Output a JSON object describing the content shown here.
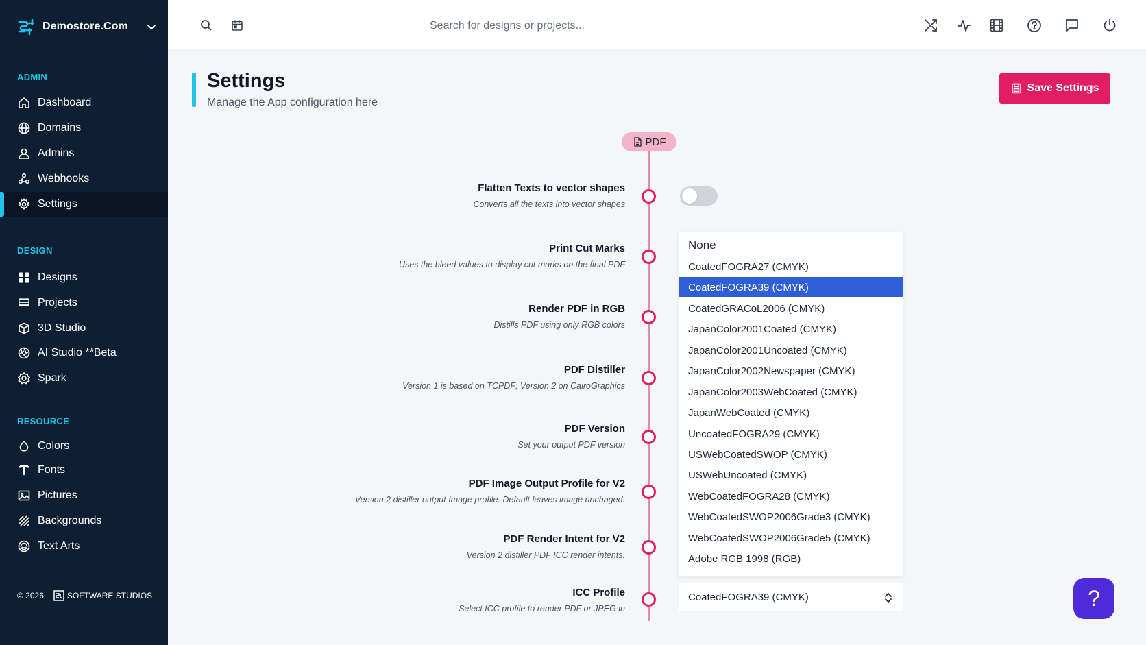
{
  "brand": {
    "name": "Demostore.Com"
  },
  "sidebar": {
    "sections": [
      {
        "label": "ADMIN",
        "items": [
          {
            "label": "Dashboard",
            "icon": "home-icon"
          },
          {
            "label": "Domains",
            "icon": "globe-icon"
          },
          {
            "label": "Admins",
            "icon": "user-icon"
          },
          {
            "label": "Webhooks",
            "icon": "webhook-icon"
          },
          {
            "label": "Settings",
            "icon": "gear-icon",
            "active": true
          }
        ]
      },
      {
        "label": "DESIGN",
        "items": [
          {
            "label": "Designs",
            "icon": "grid-icon"
          },
          {
            "label": "Projects",
            "icon": "list-icon"
          },
          {
            "label": "3D Studio",
            "icon": "cube-icon"
          },
          {
            "label": "AI Studio **Beta",
            "icon": "aperture-icon"
          },
          {
            "label": "Spark",
            "icon": "badge-gear-icon"
          }
        ]
      },
      {
        "label": "RESOURCE",
        "items": [
          {
            "label": "Colors",
            "icon": "droplet-icon"
          },
          {
            "label": "Fonts",
            "icon": "text-t-icon"
          },
          {
            "label": "Pictures",
            "icon": "image-icon"
          },
          {
            "label": "Backgrounds",
            "icon": "hatch-icon"
          },
          {
            "label": "Text Arts",
            "icon": "smiley-icon"
          }
        ]
      }
    ],
    "footer": {
      "year": "© 2026",
      "company": "SOFTWARE STUDIOS"
    }
  },
  "topbar": {
    "search_placeholder": "Search for designs or projects...",
    "icons": [
      "shuffle-icon",
      "activity-icon",
      "film-icon",
      "help-circle-icon",
      "message-icon",
      "power-icon"
    ]
  },
  "header": {
    "title": "Settings",
    "subtitle": "Manage the App configuration here",
    "save_label": "Save Settings"
  },
  "timeline": {
    "badge": "PDF"
  },
  "settings": [
    {
      "title": "Flatten Texts to vector shapes",
      "desc": "Converts all the texts into vector shapes"
    },
    {
      "title": "Print Cut Marks",
      "desc": "Uses the bleed values to display cut marks on the final PDF"
    },
    {
      "title": "Render PDF in RGB",
      "desc": "Distills PDF using only RGB colors"
    },
    {
      "title": "PDF Distiller",
      "desc": "Version 1 is based on TCPDF; Version 2 on CairoGraphics"
    },
    {
      "title": "PDF Version",
      "desc": "Set your output PDF version"
    },
    {
      "title": "PDF Image Output Profile for V2",
      "desc": "Version 2 distiller output Image profile. Default leaves image unchaged."
    },
    {
      "title": "PDF Render Intent for V2",
      "desc": "Version 2 distiller PDF ICC render intents."
    },
    {
      "title": "ICC Profile",
      "desc": "Select ICC profile to render PDF or JPEG in"
    }
  ],
  "flatten_toggle": {
    "on": false
  },
  "icc_dropdown": {
    "options": [
      "None",
      "CoatedFOGRA27 (CMYK)",
      "CoatedFOGRA39 (CMYK)",
      "CoatedGRACoL2006 (CMYK)",
      "JapanColor2001Coated (CMYK)",
      "JapanColor2001Uncoated (CMYK)",
      "JapanColor2002Newspaper (CMYK)",
      "JapanColor2003WebCoated (CMYK)",
      "JapanWebCoated (CMYK)",
      "UncoatedFOGRA29 (CMYK)",
      "USWebCoatedSWOP (CMYK)",
      "USWebUncoated (CMYK)",
      "WebCoatedFOGRA28 (CMYK)",
      "WebCoatedSWOP2006Grade3 (CMYK)",
      "WebCoatedSWOP2006Grade5 (CMYK)",
      "Adobe RGB 1998 (RGB)"
    ],
    "selected_index": 2,
    "selected_value": "CoatedFOGRA39 (CMYK)"
  },
  "help": {
    "label": "?"
  },
  "colors": {
    "accent": "#22c3e6",
    "primary": "#e11d63",
    "sidebar": "#0f1f33",
    "selection": "#2f5fd6",
    "fab": "#4f2ad9"
  }
}
